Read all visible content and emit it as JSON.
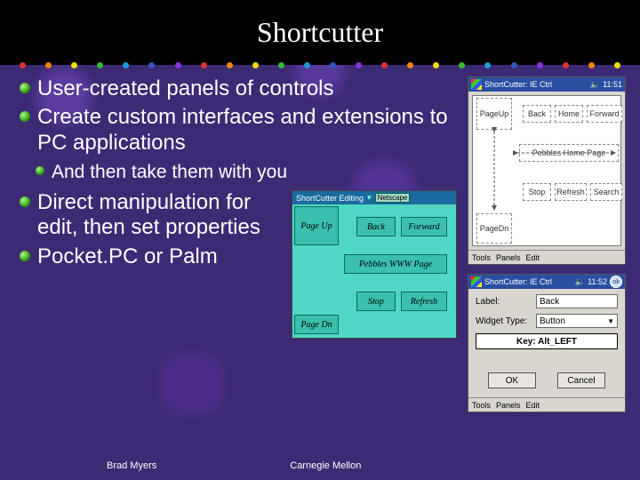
{
  "title": "Shortcutter",
  "bullets": {
    "b1": "User-created panels of controls",
    "b2": "Create custom interfaces and extensions to PC applications",
    "b2a": "And then take them with you",
    "b3": "Direct manipulation for edit, then set properties",
    "b4": "Pocket.PC or Palm"
  },
  "footer": {
    "left": "Brad Myers",
    "right": "Carnegie Mellon"
  },
  "pda1": {
    "title": "ShortCutter: IE Ctrl",
    "time": "11:51",
    "boxes": {
      "pageup": "PageUp",
      "back": "Back",
      "home": "Home",
      "forward": "Forward",
      "pebbles": "Pebbles Home Page",
      "stop": "Stop",
      "refresh": "Refresh",
      "search": "Search",
      "pagedn": "PageDn"
    },
    "bottom": {
      "tools": "Tools",
      "panels": "Panels",
      "edit": "Edit"
    }
  },
  "edit": {
    "title": "ShortCutter Editing",
    "tag": "Netscape",
    "btns": {
      "pageup": "Page Up",
      "back": "Back",
      "forward": "Forward",
      "pebbles": "Pebbles WWW Page",
      "stop": "Stop",
      "refresh": "Refresh",
      "pagedn": "Page Dn"
    }
  },
  "pda2": {
    "title": "ShortCutter: IE Ctrl",
    "time": "11:52",
    "ok": "ok",
    "label_lbl": "Label:",
    "label_val": "Back",
    "type_lbl": "Widget Type:",
    "type_val": "Button",
    "key": "Key: Alt_LEFT",
    "ok_btn": "OK",
    "cancel_btn": "Cancel",
    "bottom": {
      "tools": "Tools",
      "panels": "Panels",
      "edit": "Edit"
    }
  }
}
